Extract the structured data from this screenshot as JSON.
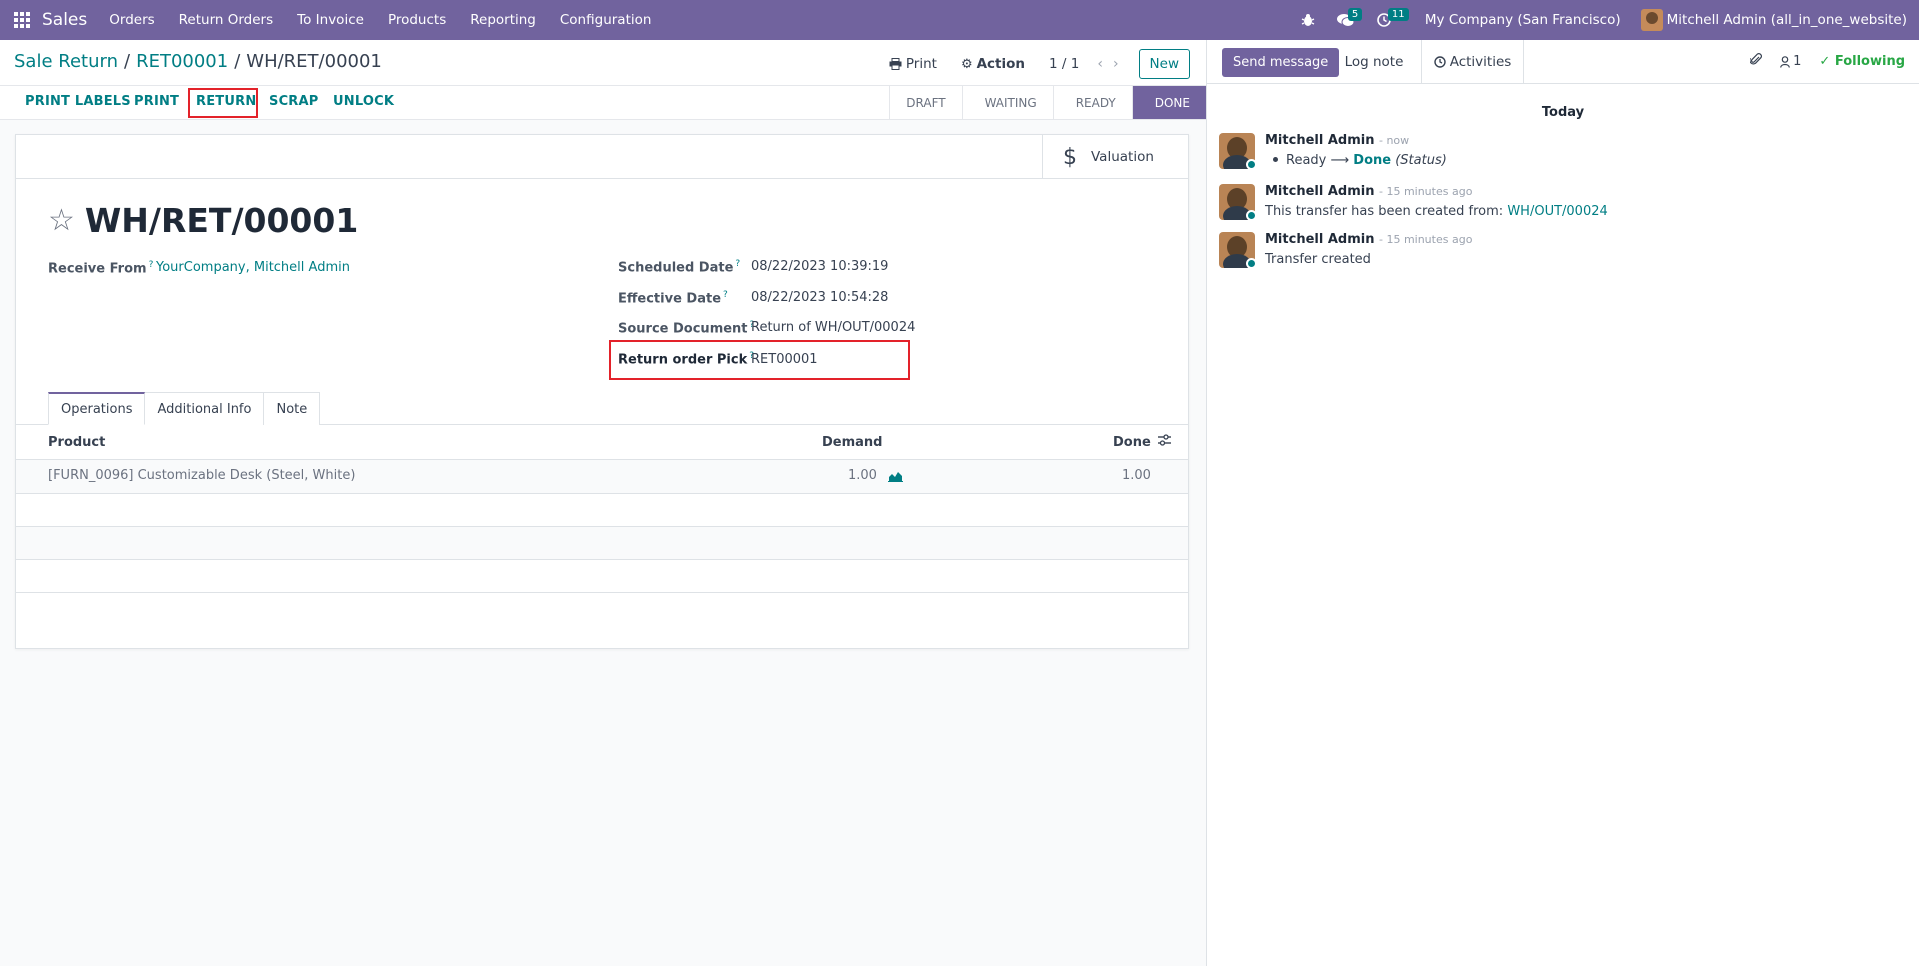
{
  "navbar": {
    "app_name": "Sales",
    "menu": [
      "Orders",
      "Return Orders",
      "To Invoice",
      "Products",
      "Reporting",
      "Configuration"
    ],
    "messages_count": "5",
    "activities_count": "11",
    "company": "My Company (San Francisco)",
    "user": "Mitchell Admin (all_in_one_website)"
  },
  "breadcrumb": {
    "root": "Sale Return",
    "parent": "RET00001",
    "current": "WH/RET/00001"
  },
  "controls": {
    "print": "Print",
    "action": "Action",
    "pager": "1 / 1",
    "new": "New"
  },
  "actions": {
    "print_labels": "PRINT LABELS",
    "print": "PRINT",
    "return": "RETURN",
    "scrap": "SCRAP",
    "unlock": "UNLOCK"
  },
  "stages": [
    "DRAFT",
    "WAITING",
    "READY",
    "DONE"
  ],
  "active_stage": "DONE",
  "button_box": {
    "valuation": "Valuation"
  },
  "record": {
    "name": "WH/RET/00001",
    "receive_from_label": "Receive From",
    "receive_from": "YourCompany, Mitchell Admin",
    "scheduled_date_label": "Scheduled Date",
    "scheduled_date": "08/22/2023 10:39:19",
    "effective_date_label": "Effective Date",
    "effective_date": "08/22/2023 10:54:28",
    "source_document_label": "Source Document",
    "source_document": "Return of WH/OUT/00024",
    "return_order_pick_label": "Return order Pick",
    "return_order_pick": "RET00001"
  },
  "tabs": [
    "Operations",
    "Additional Info",
    "Note"
  ],
  "table": {
    "headers": {
      "product": "Product",
      "demand": "Demand",
      "done": "Done"
    },
    "rows": [
      {
        "product": "[FURN_0096] Customizable Desk (Steel, White)",
        "demand": "1.00",
        "done": "1.00"
      }
    ]
  },
  "chatter": {
    "send_message": "Send message",
    "log_note": "Log note",
    "activities": "Activities",
    "followers": "1",
    "following": "Following",
    "date_separator": "Today",
    "messages": [
      {
        "author": "Mitchell Admin",
        "time": "- now",
        "from": "Ready",
        "to": "Done",
        "field": "(Status)"
      },
      {
        "author": "Mitchell Admin",
        "time": "- 15 minutes ago",
        "text": "This transfer has been created from:",
        "link": "WH/OUT/00024"
      },
      {
        "author": "Mitchell Admin",
        "time": "- 15 minutes ago",
        "text": "Transfer created"
      }
    ]
  },
  "colors": {
    "brand": "#71639e",
    "link": "#017e84",
    "highlight": "#e3222a",
    "following": "#28a745"
  }
}
